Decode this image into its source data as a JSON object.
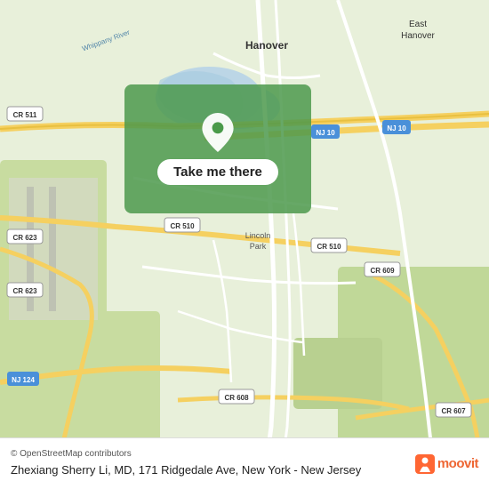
{
  "map": {
    "alt": "Map showing Zhexiang Sherry Li MD location in New Jersey",
    "background_color": "#e8f0d8"
  },
  "destination_box": {
    "button_label": "Take me there",
    "pin_alt": "location pin"
  },
  "bottom_bar": {
    "attribution": "© OpenStreetMap contributors",
    "address": "Zhexiang Sherry Li, MD, 171 Ridgedale Ave, New York - New Jersey",
    "logo_text": "moovit"
  }
}
